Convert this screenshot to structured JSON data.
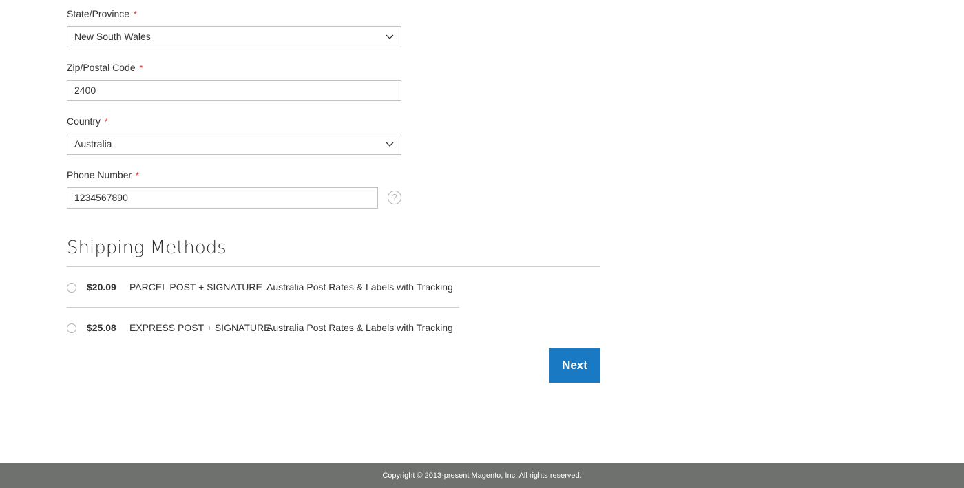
{
  "form": {
    "state": {
      "label": "State/Province",
      "required_mark": "*",
      "value": "New South Wales"
    },
    "zip": {
      "label": "Zip/Postal Code",
      "required_mark": "*",
      "value": "2400"
    },
    "country": {
      "label": "Country",
      "required_mark": "*",
      "value": "Australia"
    },
    "phone": {
      "label": "Phone Number",
      "required_mark": "*",
      "value": "1234567890",
      "help_icon": "question-mark-icon",
      "help_glyph": "?"
    }
  },
  "shipping": {
    "title": "Shipping Methods",
    "methods": [
      {
        "price": "$20.09",
        "method": "PARCEL POST + SIGNATURE",
        "carrier": "Australia Post Rates & Labels with Tracking",
        "selected": false
      },
      {
        "price": "$25.08",
        "method": "EXPRESS POST + SIGNATURE",
        "carrier": "Australia Post Rates & Labels with Tracking",
        "selected": false
      }
    ],
    "next_label": "Next"
  },
  "footer": {
    "copyright": "Copyright © 2013-present Magento, Inc. All rights reserved."
  },
  "colors": {
    "accent": "#1979c3",
    "required": "#e02b27",
    "footer_bg": "#6e716e"
  }
}
